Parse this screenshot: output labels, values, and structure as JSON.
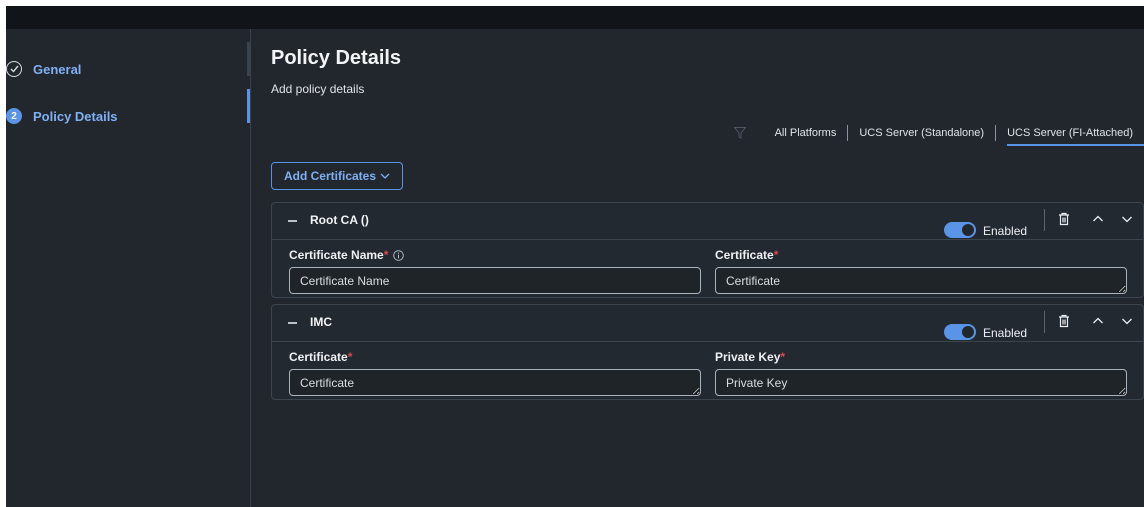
{
  "steps": [
    {
      "label": "General",
      "state": "done"
    },
    {
      "label": "Policy Details",
      "number": "2",
      "state": "current"
    }
  ],
  "page": {
    "title": "Policy Details",
    "subtitle": "Add policy details"
  },
  "filters": {
    "icon": "filter-icon",
    "tabs": [
      "All Platforms",
      "UCS Server (Standalone)",
      "UCS Server (FI-Attached)"
    ],
    "active": "UCS Server (FI-Attached)"
  },
  "add_certificates": {
    "label": "Add Certificates"
  },
  "sections": [
    {
      "title": "Root CA ()",
      "toggle_label": "Enabled",
      "enabled": true,
      "fields": [
        {
          "label": "Certificate Name",
          "required": "*",
          "placeholder": "Certificate Name",
          "has_info": true
        },
        {
          "label": "Certificate",
          "required": "*",
          "placeholder": "Certificate"
        }
      ]
    },
    {
      "title": "IMC",
      "toggle_label": "Enabled",
      "enabled": true,
      "fields": [
        {
          "label": "Certificate",
          "required": "*",
          "placeholder": "Certificate"
        },
        {
          "label": "Private Key",
          "required": "*",
          "placeholder": "Private Key"
        }
      ]
    }
  ],
  "colors": {
    "background": "#22272e",
    "accent": "#5a94e6",
    "link": "#7fb0f3",
    "required": "#e0474c"
  }
}
